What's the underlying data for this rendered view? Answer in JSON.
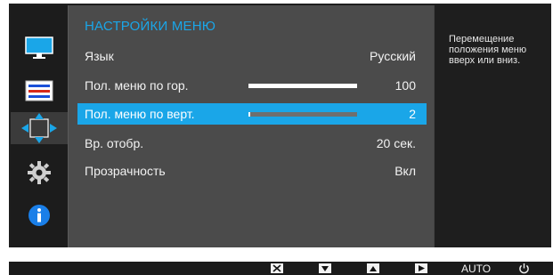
{
  "menu": {
    "title": "НАСТРОЙКИ МЕНЮ",
    "items": [
      {
        "label": "Язык",
        "value": "Русский"
      },
      {
        "label": "Пол. меню по гор.",
        "value": "100",
        "level": 1.0
      },
      {
        "label": "Пол. меню по верт.",
        "value": "2",
        "level": 0.02
      },
      {
        "label": "Вр. отобр.",
        "value": "20 сек."
      },
      {
        "label": "Прозрачность",
        "value": "Вкл"
      }
    ]
  },
  "help": {
    "text": "Перемещение положения меню вверх или вниз."
  },
  "bottom": {
    "auto_label": "AUTO"
  },
  "sidebar": {
    "icons": [
      "monitor-icon",
      "settings-list-icon",
      "position-arrows-icon",
      "gear-icon",
      "info-icon"
    ]
  },
  "colors": {
    "accent": "#1aa6e8",
    "panel": "#4b4b4b",
    "background": "#1e1e1e"
  }
}
